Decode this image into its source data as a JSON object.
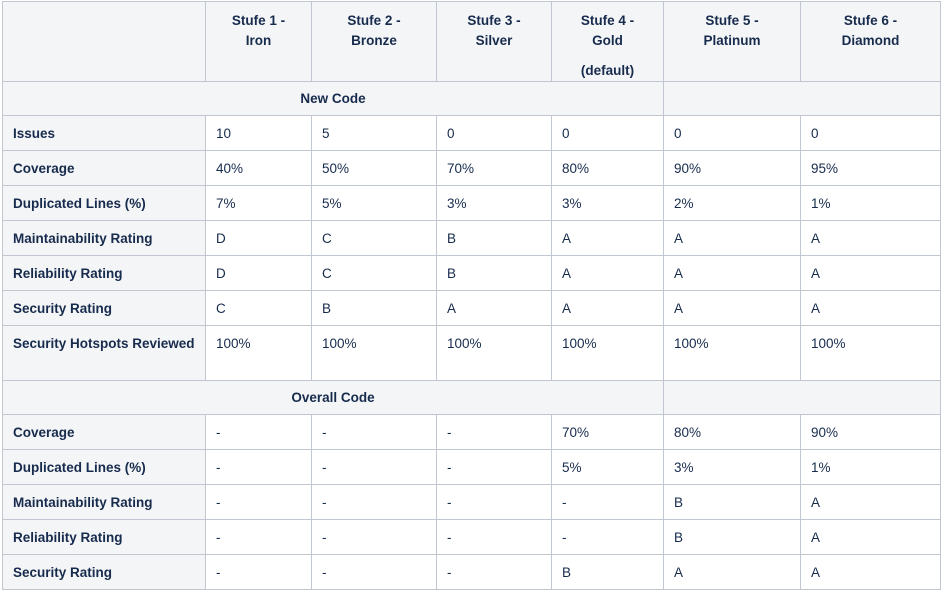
{
  "columns": [
    {
      "line1": "Stufe 1 -",
      "line2": "Iron",
      "note": ""
    },
    {
      "line1": "Stufe 2 -",
      "line2": "Bronze",
      "note": ""
    },
    {
      "line1": "Stufe 3 -",
      "line2": "Silver",
      "note": ""
    },
    {
      "line1": "Stufe 4 -",
      "line2": "Gold",
      "note": "(default)"
    },
    {
      "line1": "Stufe 5 -",
      "line2": "Platinum",
      "note": ""
    },
    {
      "line1": "Stufe 6 -",
      "line2": "Diamond",
      "note": ""
    }
  ],
  "sections": [
    {
      "title": "New Code",
      "rows": [
        {
          "label": "Issues",
          "values": [
            "10",
            "5",
            "0",
            "0",
            "0",
            "0"
          ]
        },
        {
          "label": "Coverage",
          "values": [
            "40%",
            "50%",
            "70%",
            "80%",
            "90%",
            "95%"
          ]
        },
        {
          "label": "Duplicated Lines (%)",
          "values": [
            "7%",
            "5%",
            "3%",
            "3%",
            "2%",
            "1%"
          ]
        },
        {
          "label": "Maintainability Rating",
          "values": [
            "D",
            "C",
            "B",
            "A",
            "A",
            "A"
          ]
        },
        {
          "label": "Reliability Rating",
          "values": [
            "D",
            "C",
            "B",
            "A",
            "A",
            "A"
          ]
        },
        {
          "label": "Security Rating",
          "values": [
            "C",
            "B",
            "A",
            "A",
            "A",
            "A"
          ]
        },
        {
          "label": "Security Hotspots Reviewed",
          "values": [
            "100%",
            "100%",
            "100%",
            "100%",
            "100%",
            "100%"
          ],
          "tall": true
        }
      ]
    },
    {
      "title": "Overall Code",
      "rows": [
        {
          "label": "Coverage",
          "values": [
            "-",
            "-",
            "-",
            "70%",
            "80%",
            "90%"
          ]
        },
        {
          "label": "Duplicated Lines (%)",
          "values": [
            "-",
            "-",
            "-",
            "5%",
            "3%",
            "1%"
          ]
        },
        {
          "label": "Maintainability Rating",
          "values": [
            "-",
            "-",
            "-",
            "-",
            "B",
            "A"
          ]
        },
        {
          "label": "Reliability Rating",
          "values": [
            "-",
            "-",
            "-",
            "-",
            "B",
            "A"
          ]
        },
        {
          "label": "Security Rating",
          "values": [
            "-",
            "-",
            "-",
            "B",
            "A",
            "A"
          ]
        }
      ]
    }
  ]
}
